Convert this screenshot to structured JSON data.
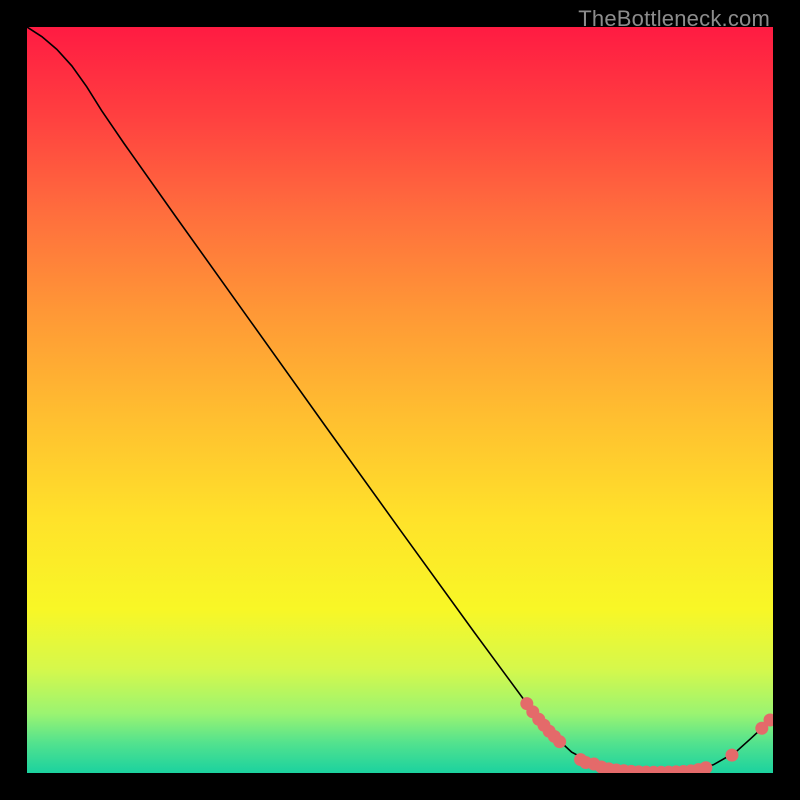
{
  "watermark": "TheBottleneck.com",
  "chart_data": {
    "type": "line",
    "title": "",
    "xlabel": "",
    "ylabel": "",
    "xlim": [
      0,
      100
    ],
    "ylim": [
      0,
      100
    ],
    "grid": false,
    "series": [
      {
        "name": "curve",
        "color": "#000000",
        "stroke_width": 1.6,
        "points": [
          {
            "x": 0.0,
            "y": 100.0
          },
          {
            "x": 2.0,
            "y": 98.7
          },
          {
            "x": 4.0,
            "y": 97.0
          },
          {
            "x": 6.0,
            "y": 94.8
          },
          {
            "x": 8.0,
            "y": 92.0
          },
          {
            "x": 10.0,
            "y": 88.8
          },
          {
            "x": 13.0,
            "y": 84.4
          },
          {
            "x": 20.0,
            "y": 74.5
          },
          {
            "x": 30.0,
            "y": 60.5
          },
          {
            "x": 40.0,
            "y": 46.5
          },
          {
            "x": 50.0,
            "y": 32.6
          },
          {
            "x": 60.0,
            "y": 18.8
          },
          {
            "x": 67.0,
            "y": 9.3
          },
          {
            "x": 70.0,
            "y": 5.6
          },
          {
            "x": 73.0,
            "y": 2.8
          },
          {
            "x": 76.0,
            "y": 1.2
          },
          {
            "x": 80.0,
            "y": 0.3
          },
          {
            "x": 84.0,
            "y": 0.1
          },
          {
            "x": 88.0,
            "y": 0.2
          },
          {
            "x": 92.0,
            "y": 1.1
          },
          {
            "x": 95.0,
            "y": 2.8
          },
          {
            "x": 97.0,
            "y": 4.6
          },
          {
            "x": 98.5,
            "y": 6.0
          },
          {
            "x": 99.6,
            "y": 7.1
          }
        ]
      },
      {
        "name": "markers",
        "color": "#e46a6a",
        "marker_radius": 6.5,
        "points": [
          {
            "x": 67.0,
            "y": 9.3
          },
          {
            "x": 67.8,
            "y": 8.2
          },
          {
            "x": 68.6,
            "y": 7.2
          },
          {
            "x": 69.3,
            "y": 6.4
          },
          {
            "x": 70.0,
            "y": 5.6
          },
          {
            "x": 70.7,
            "y": 4.9
          },
          {
            "x": 71.4,
            "y": 4.2
          },
          {
            "x": 74.2,
            "y": 1.8
          },
          {
            "x": 74.9,
            "y": 1.4
          },
          {
            "x": 76.0,
            "y": 1.2
          },
          {
            "x": 77.0,
            "y": 0.8
          },
          {
            "x": 78.0,
            "y": 0.55
          },
          {
            "x": 79.0,
            "y": 0.4
          },
          {
            "x": 80.0,
            "y": 0.3
          },
          {
            "x": 81.0,
            "y": 0.22
          },
          {
            "x": 82.0,
            "y": 0.15
          },
          {
            "x": 83.0,
            "y": 0.12
          },
          {
            "x": 84.0,
            "y": 0.1
          },
          {
            "x": 85.0,
            "y": 0.1
          },
          {
            "x": 86.0,
            "y": 0.12
          },
          {
            "x": 87.0,
            "y": 0.15
          },
          {
            "x": 88.0,
            "y": 0.2
          },
          {
            "x": 89.0,
            "y": 0.28
          },
          {
            "x": 90.0,
            "y": 0.45
          },
          {
            "x": 91.0,
            "y": 0.7
          },
          {
            "x": 94.5,
            "y": 2.4
          },
          {
            "x": 98.5,
            "y": 6.0
          },
          {
            "x": 99.6,
            "y": 7.1
          }
        ]
      }
    ]
  }
}
